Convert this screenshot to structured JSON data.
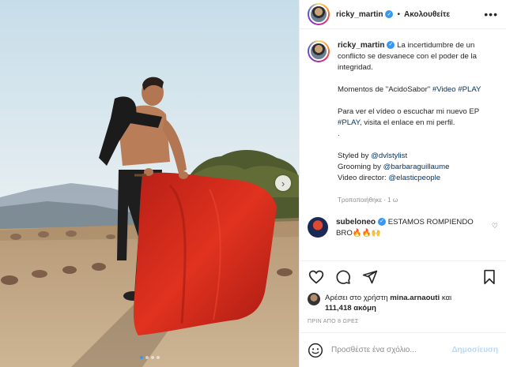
{
  "post": {
    "username": "ricky_martin",
    "verified": true,
    "follow_label": "Ακολουθείτε",
    "separator": "•",
    "more_label": "•••",
    "caption": {
      "line1": "La incertidumbre de un conflicto se desvanece con el poder de la integridad.",
      "line2_prefix": "Momentos de \"AcidoSabor\" ",
      "hashtag_video": "#Video",
      "hashtag_play": "#PLAY",
      "line3_prefix": "Para ver el vídeo o escuchar mi nuevo EP ",
      "line3_suffix": ", visita el enlace en mi perfil.",
      "dot": ".",
      "styled_prefix": "Styled by ",
      "styled_mention": "@dvlstylist",
      "grooming_prefix": "Grooming by ",
      "grooming_mention": "@barbaraguillaume",
      "director_prefix": "Video director: ",
      "director_mention": "@elasticpeople"
    },
    "edited_meta": "Τροποποιήθηκε · 1 ω",
    "comment": {
      "username": "subeloneo",
      "text": "ESTAMOS ROMPIENDO BRO🔥🔥🙌"
    },
    "likes": {
      "prefix": "Αρέσει στο χρήστη ",
      "user": "mina.arnaouti",
      "middle": " και ",
      "count": "111,418 ακόμη"
    },
    "time_ago": "ΠΡΙΝ ΑΠΟ 8 ΩΡΕΣ",
    "comment_input_placeholder": "Προσθέστε ένα σχόλιο...",
    "post_button_label": "Δημοσίευση",
    "carousel": {
      "next_label": "›",
      "total_slides": 4,
      "active_slide": 1
    }
  },
  "icons": [
    "verified-icon",
    "more-icon",
    "heart-icon",
    "comment-icon",
    "share-icon",
    "save-icon",
    "emoji-icon",
    "next-arrow-icon"
  ],
  "colors": {
    "link": "#00376b",
    "verified": "#3897f0",
    "post_button_disabled": "#b3dbff",
    "muted": "#8e8e8e",
    "cape": "#d42a1f"
  }
}
